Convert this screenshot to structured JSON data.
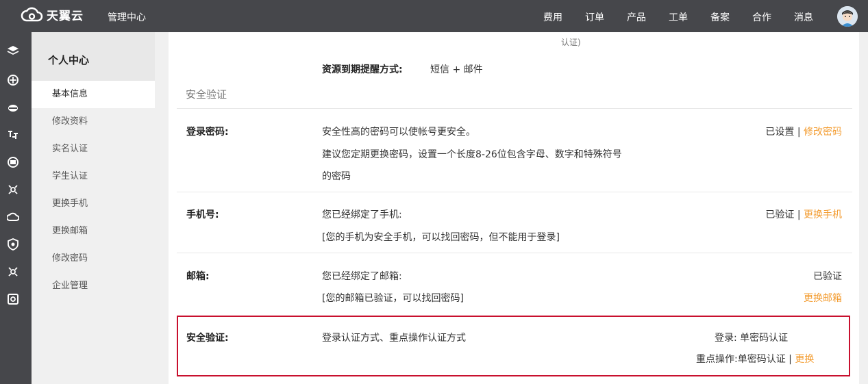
{
  "topbar": {
    "logo_text": "天翼云",
    "mgmt_label": "管理中心",
    "nav": [
      "费用",
      "订单",
      "产品",
      "工单",
      "备案",
      "合作",
      "消息"
    ]
  },
  "sidebar": {
    "title": "个人中心",
    "items": [
      "基本信息",
      "修改资料",
      "实名认证",
      "学生认证",
      "更换手机",
      "更换邮箱",
      "修改密码",
      "企业管理"
    ]
  },
  "main": {
    "top_partial": "认证)",
    "expiry_label": "资源到期提醒方式:",
    "expiry_value": "短信 + 邮件",
    "section_title": "安全验证",
    "password": {
      "label": "登录密码:",
      "line1": "安全性高的密码可以使帐号更安全。",
      "line2": "建议您定期更换密码，设置一个长度8-26位包含字母、数字和特殊符号",
      "line3": "的密码",
      "status": "已设置",
      "sep": "|",
      "action": "修改密码"
    },
    "phone": {
      "label": "手机号:",
      "line1": "您已经绑定了手机:",
      "line2": "[您的手机为安全手机，可以找回密码，但不能用于登录]",
      "status": "已验证",
      "sep": "|",
      "action": "更换手机"
    },
    "email": {
      "label": "邮箱:",
      "line1": "您已经绑定了邮箱:",
      "line2": "[您的邮箱已验证，可以找回密码]",
      "status": "已验证",
      "action": "更换邮箱"
    },
    "security": {
      "label": "安全验证:",
      "desc": "登录认证方式、重点操作认证方式",
      "login_line": "登录: 单密码认证",
      "op_line": "重点操作:单密码认证",
      "sep": "|",
      "action": "更换"
    }
  },
  "colors": {
    "topbar_bg": "#46474b",
    "accent_orange": "#f39c30",
    "highlight_red": "#c8102e"
  }
}
